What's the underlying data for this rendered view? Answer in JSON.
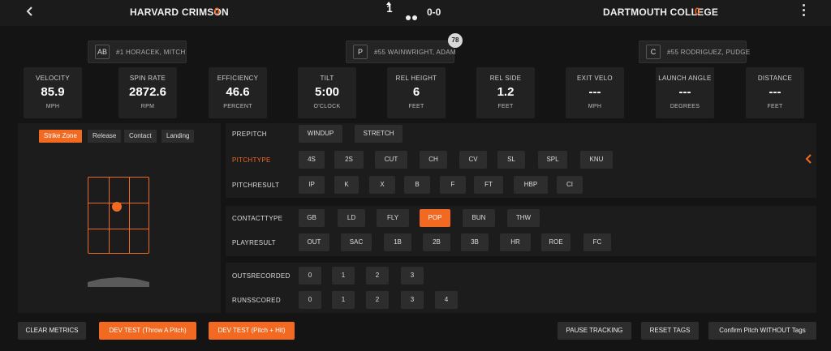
{
  "header": {
    "home_team": "HARVARD CRIMSON",
    "home_score": "0",
    "away_team": "DARTMOUTH COLLEGE",
    "away_score": "0",
    "inning": "1",
    "count": "0-0",
    "outs_dots": 2,
    "accent_color": "#f26a22"
  },
  "players": {
    "batter": {
      "pos": "AB",
      "name": "#1 HORACEK, MITCH"
    },
    "pitcher": {
      "pos": "P",
      "name": "#55 WAINWRIGHT, ADAM"
    },
    "pitch_count": "78",
    "catcher": {
      "pos": "C",
      "name": "#55 RODRIGUEZ, PUDGE"
    }
  },
  "metrics": [
    {
      "label": "VELOCITY",
      "value": "85.9",
      "unit": "MPH"
    },
    {
      "label": "SPIN RATE",
      "value": "2872.6",
      "unit": "RPM"
    },
    {
      "label": "EFFICIENCY",
      "value": "46.6",
      "unit": "PERCENT"
    },
    {
      "label": "TILT",
      "value": "5:00",
      "unit": "O'CLOCK"
    },
    {
      "label": "REL HEIGHT",
      "value": "6",
      "unit": "FEET"
    },
    {
      "label": "REL SIDE",
      "value": "1.2",
      "unit": "FEET"
    },
    {
      "label": "EXIT VELO",
      "value": "---",
      "unit": "MPH"
    },
    {
      "label": "LAUNCH ANGLE",
      "value": "---",
      "unit": "DEGREES"
    },
    {
      "label": "DISTANCE",
      "value": "---",
      "unit": "FEET"
    }
  ],
  "view_tabs": [
    "Strike Zone",
    "Release",
    "Contact",
    "Landing"
  ],
  "active_view_tab": "Strike Zone",
  "tags": {
    "prepitch": {
      "label": "PREPITCH",
      "options": [
        "WINDUP",
        "STRETCH"
      ]
    },
    "pitchtype": {
      "label": "PITCHTYPE",
      "options": [
        "4S",
        "2S",
        "CUT",
        "CH",
        "CV",
        "SL",
        "SPL",
        "KNU"
      ]
    },
    "pitchresult": {
      "label": "PITCHRESULT",
      "options": [
        "IP",
        "K",
        "X",
        "B",
        "F",
        "FT",
        "HBP",
        "CI"
      ]
    },
    "contacttype": {
      "label": "CONTACTTYPE",
      "options": [
        "GB",
        "LD",
        "FLY",
        "POP",
        "BUN",
        "THW"
      ],
      "selected": "POP"
    },
    "playresult": {
      "label": "PLAYRESULT",
      "options": [
        "OUT",
        "SAC",
        "1B",
        "2B",
        "3B",
        "HR",
        "ROE",
        "FC"
      ]
    },
    "outsrecorded": {
      "label": "OUTSRECORDED",
      "options": [
        "0",
        "1",
        "2",
        "3"
      ]
    },
    "runsscored": {
      "label": "RUNSSCORED",
      "options": [
        "0",
        "1",
        "2",
        "3",
        "4"
      ]
    }
  },
  "footer": {
    "clear_metrics": "CLEAR METRICS",
    "dev_test_throw": "DEV TEST (Throw A Pitch)",
    "dev_test_hit": "DEV TEST (Pitch + Hit)",
    "pause_tracking": "PAUSE TRACKING",
    "reset_tags": "RESET TAGS",
    "confirm_pitch": "Confirm Pitch WITHOUT Tags"
  }
}
